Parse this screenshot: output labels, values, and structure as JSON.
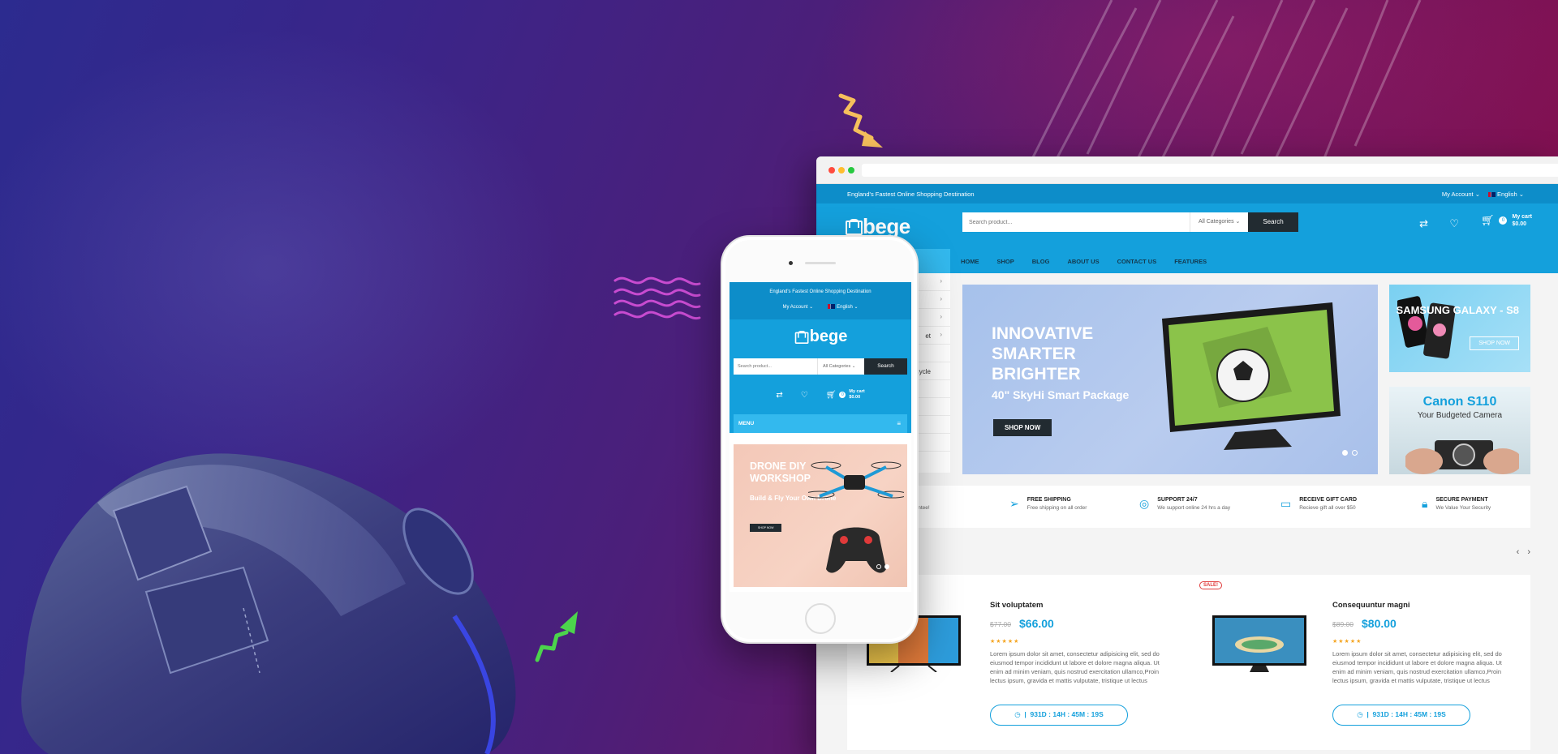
{
  "colors": {
    "primary": "#14a0dc",
    "dark": "#222b31",
    "accent_sale": "#e03a3a",
    "star": "#f5a623"
  },
  "desktop": {
    "top_bar": {
      "tagline": "England's Fastest Online Shopping Destination",
      "account": "My Account ⌄",
      "language": "English ⌄"
    },
    "header": {
      "logo": "bege",
      "search_placeholder": "Search product...",
      "category": "All Categories",
      "search_button": "Search",
      "cart_count": "0",
      "cart_label": "My cart",
      "cart_total": "$0.00"
    },
    "nav": [
      "HOME",
      "SHOP",
      "BLOG",
      "ABOUT US",
      "CONTACT US",
      "FEATURES"
    ],
    "side_menu_partial": [
      "et",
      "cycle"
    ],
    "hero": {
      "title": "INNOVATIVE SMARTER BRIGHTER",
      "subtitle": "40\" SkyHi Smart Package",
      "button": "SHOP NOW"
    },
    "promo1": {
      "title": "SAMSUNG GALAXY - S8",
      "button": "SHOP NOW"
    },
    "promo2": {
      "title": "Canon S110",
      "subtitle": "Your Budgeted Camera"
    },
    "features": [
      {
        "title": "N",
        "subtitle": "y back guarantee!"
      },
      {
        "title": "FREE SHIPPING",
        "subtitle": "Free shipping on all order"
      },
      {
        "title": "SUPPORT 24/7",
        "subtitle": "We support online 24 hrs a day"
      },
      {
        "title": "RECEIVE GIFT CARD",
        "subtitle": "Recieve gift all over $50"
      },
      {
        "title": "SECURE PAYMENT",
        "subtitle": "We Value Your Security"
      }
    ],
    "products": [
      {
        "name": "Sit voluptatem",
        "old_price": "$77.00",
        "price": "$66.00",
        "stars": "★★★★★",
        "desc": "Lorem ipsum dolor sit amet, consectetur adipisicing elit, sed do eiusmod tempor incididunt ut labore et dolore magna aliqua. Ut enim ad minim veniam, quis nostrud exercitation ullamco,Proin lectus ipsum, gravida et mattis vulputate, tristique ut lectus",
        "timer": "931D : 14H : 45M : 19S"
      },
      {
        "name": "Consequuntur magni",
        "old_price": "$89.00",
        "price": "$80.00",
        "stars": "★★★★★",
        "desc": "Lorem ipsum dolor sit amet, consectetur adipisicing elit, sed do eiusmod tempor incididunt ut labore et dolore magna aliqua. Ut enim ad minim veniam, quis nostrud exercitation ullamco,Proin lectus ipsum, gravida et mattis vulputate, tristique ut lectus",
        "timer": "931D : 14H : 45M : 19S",
        "badge": "SALE!"
      }
    ]
  },
  "mobile": {
    "tagline": "England's Fastest Online Shopping Destination",
    "account": "My Account ⌄",
    "language": "English ⌄",
    "logo": "bege",
    "search_placeholder": "Search product...",
    "category": "All Categories",
    "search_button": "Search",
    "cart_count": "0",
    "cart_label": "My cart",
    "cart_total": "$0.00",
    "menu": "MENU",
    "banner": {
      "title": "DRONE DIY WORKSHOP",
      "subtitle": "Build & Fly Your Own Drone",
      "button": "SHOP NOW"
    }
  }
}
